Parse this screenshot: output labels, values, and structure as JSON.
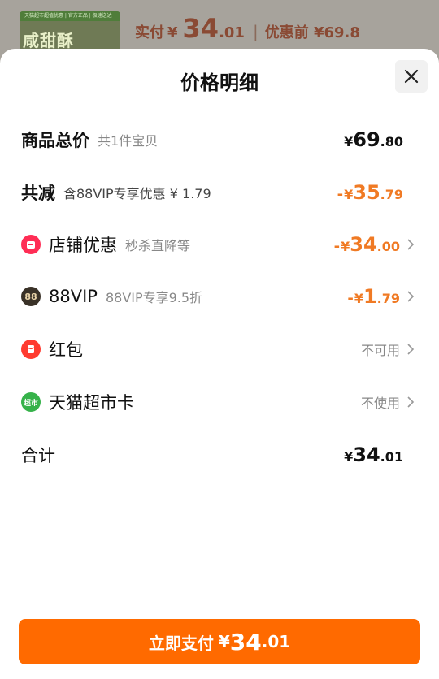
{
  "background": {
    "thumb_bar_text": "天猫超市超值优惠 | 官方正品 | 极速送达",
    "thumb_name": "咸甜酥",
    "paid_label": "实付",
    "currency": "¥",
    "paid_int": "34",
    "paid_dec": ".01",
    "separator": "|",
    "before_label": "优惠前 ¥69.8"
  },
  "sheet": {
    "title": "价格明细",
    "close_icon": "close-icon"
  },
  "rows": {
    "total": {
      "label": "商品总价",
      "sub": "共1件宝贝",
      "currency": "¥",
      "int": "69",
      "dec": ".80"
    },
    "discount": {
      "label": "共减",
      "sub": "含88VIP专享优惠 ¥ 1.79",
      "minus": "-",
      "currency": "¥",
      "int": "35",
      "dec": ".79"
    },
    "store": {
      "icon": "store-icon",
      "label": "店铺优惠",
      "sub": "秒杀直降等",
      "minus": "-",
      "currency": "¥",
      "int": "34",
      "dec": ".00"
    },
    "vip": {
      "icon": "vip88-icon",
      "icon_text": "88",
      "label": "88VIP",
      "sub": "88VIP专享9.5折",
      "minus": "-",
      "currency": "¥",
      "int": "1",
      "dec": ".79"
    },
    "hongbao": {
      "icon": "red-packet-icon",
      "label": "红包",
      "status": "不可用"
    },
    "supermarket": {
      "icon": "supermarket-card-icon",
      "icon_text": "超市",
      "label": "天猫超市卡",
      "status": "不使用"
    },
    "sum": {
      "label": "合计",
      "currency": "¥",
      "int": "34",
      "dec": ".01"
    }
  },
  "pay_button": {
    "label": "立即支付",
    "currency": "¥",
    "int": "34",
    "dec": ".01"
  },
  "colors": {
    "accent_orange": "#ff6a00",
    "discount_orange": "#f07a24"
  }
}
